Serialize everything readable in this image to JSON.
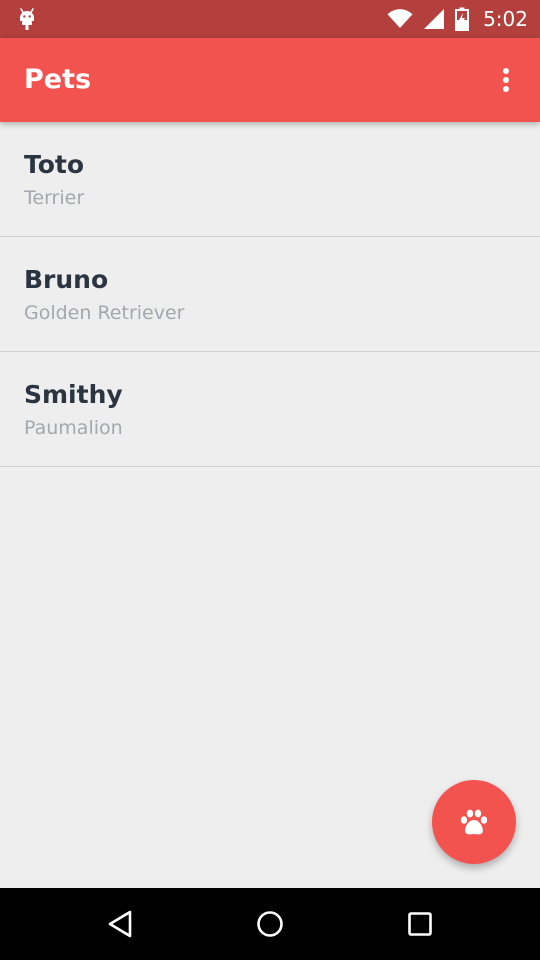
{
  "status_bar": {
    "time": "5:02",
    "icons": [
      "android-debug-icon",
      "wifi-icon",
      "cell-signal-icon",
      "battery-charging-icon"
    ],
    "background": "#b3403c"
  },
  "app_bar": {
    "title": "Pets",
    "background": "#f3534f",
    "menu_icon": "more-vert-icon"
  },
  "pets": [
    {
      "name": "Toto",
      "breed": "Terrier"
    },
    {
      "name": "Bruno",
      "breed": "Golden Retriever"
    },
    {
      "name": "Smithy",
      "breed": "Paumalion"
    }
  ],
  "fab": {
    "icon": "paw-icon",
    "background": "#f3534f"
  },
  "nav_bar": {
    "icons": [
      "back-icon",
      "home-icon",
      "recents-icon"
    ]
  },
  "colors": {
    "accent": "#f3534f",
    "primary_dark": "#b3403c",
    "name_text": "#2b3542",
    "breed_text": "#a3a8ae",
    "background": "#eeeeee"
  }
}
